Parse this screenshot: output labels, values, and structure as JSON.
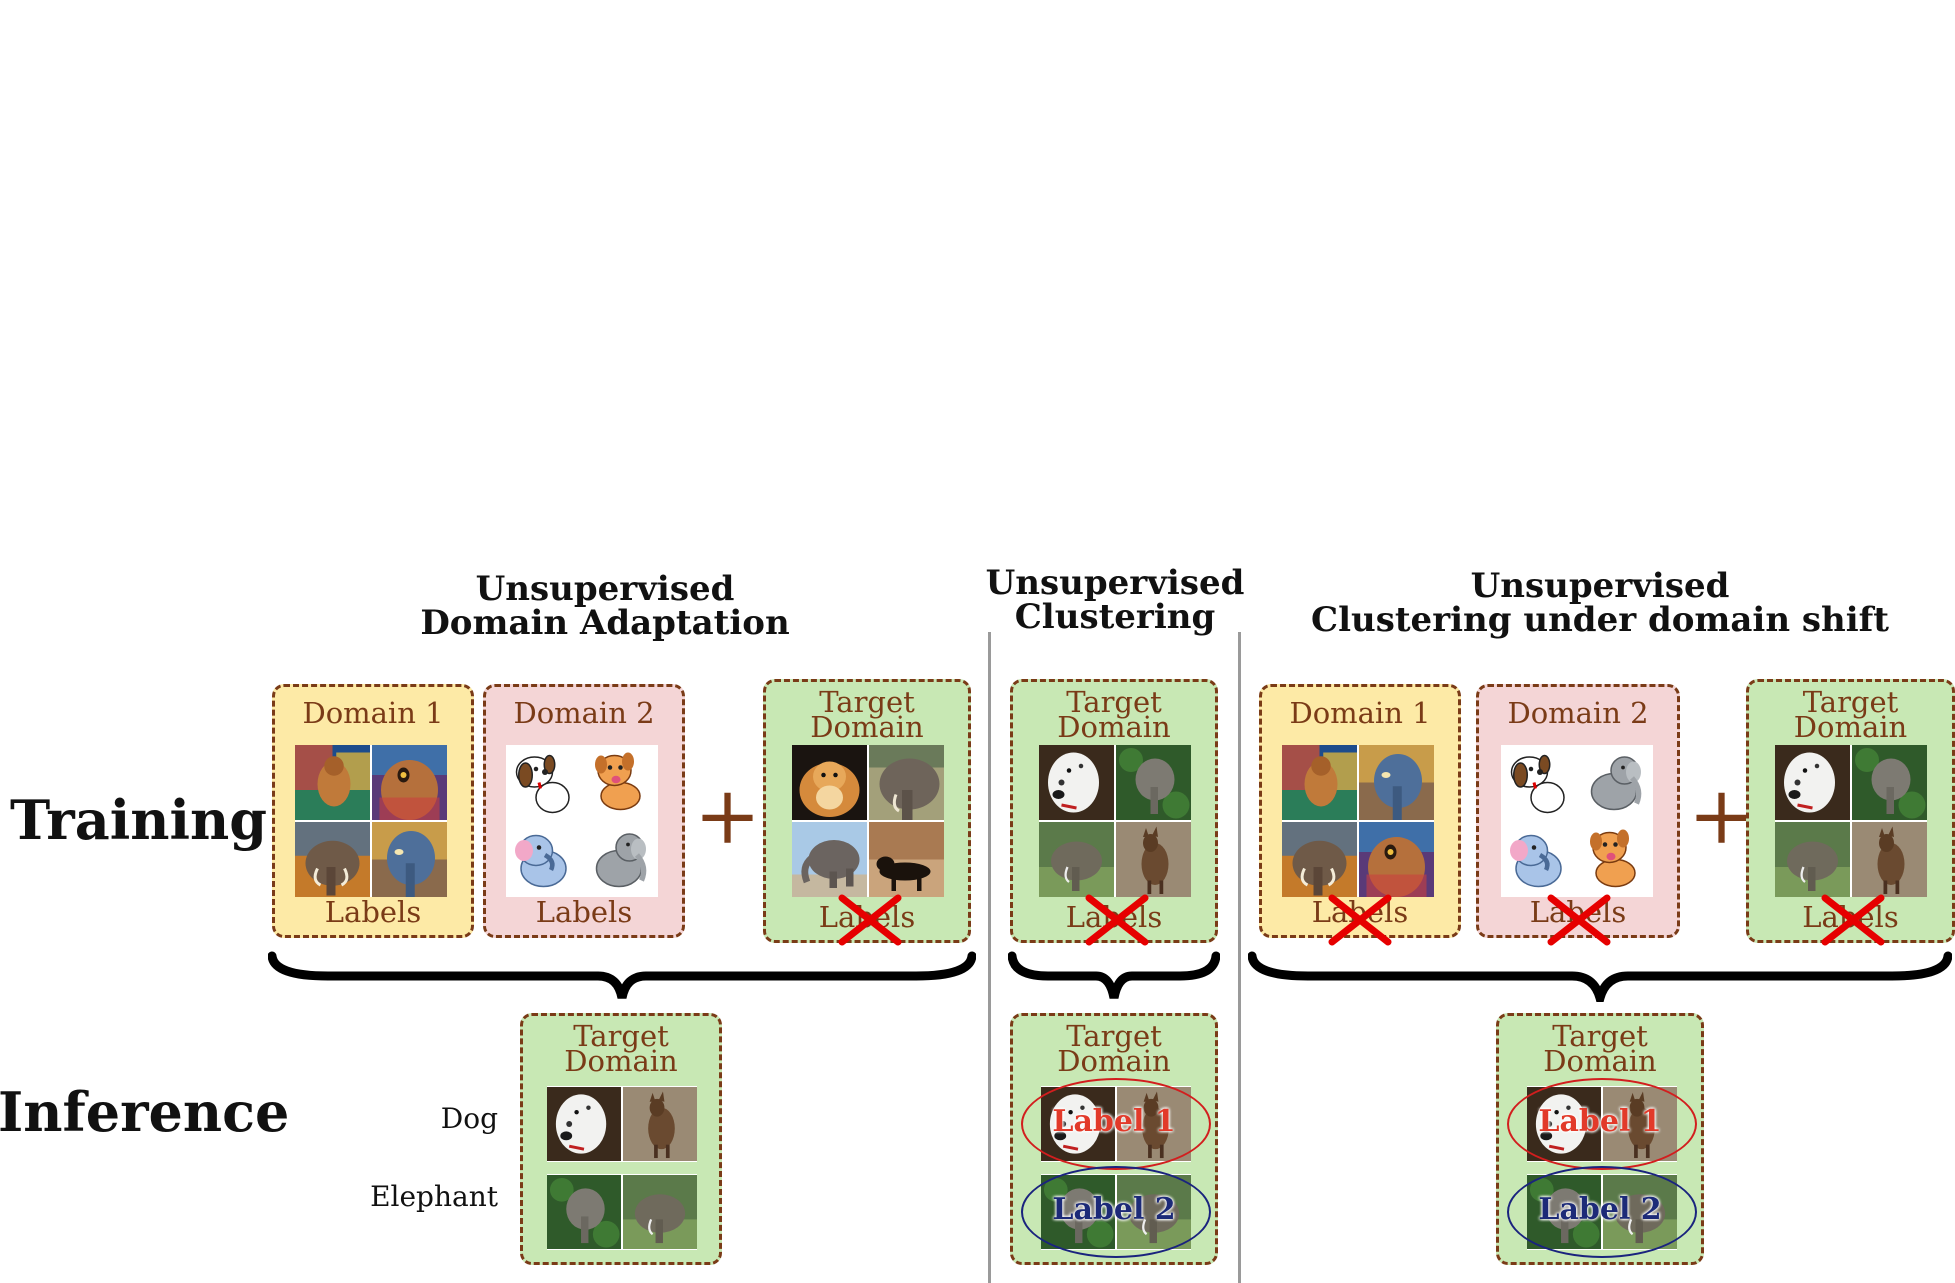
{
  "rows": {
    "training": "Training",
    "inference": "Inference"
  },
  "sections": {
    "uda": {
      "title_line1": "Unsupervised",
      "title_line2": "Domain Adaptation"
    },
    "uc": {
      "title_line1": "Unsupervised",
      "title_line2": "Clustering"
    },
    "ucds": {
      "title_line1": "Unsupervised",
      "title_line2": "Clustering under domain shift"
    }
  },
  "boxes": {
    "domain1": "Domain 1",
    "domain2": "Domain 2",
    "target_line1": "Target",
    "target_line2": "Domain",
    "labels": "Labels"
  },
  "inference": {
    "dog": "Dog",
    "elephant": "Elephant",
    "label1": "Label 1",
    "label2": "Label 2"
  },
  "symbols": {
    "plus": "+"
  },
  "colors": {
    "domain1_bg": "#fdeaa6",
    "domain2_bg": "#f4d5d6",
    "target_bg": "#c8e8b4",
    "box_border": "#7a3b17",
    "cross": "#e60000",
    "label1": "#e23a2a",
    "label2": "#1c2a78"
  }
}
